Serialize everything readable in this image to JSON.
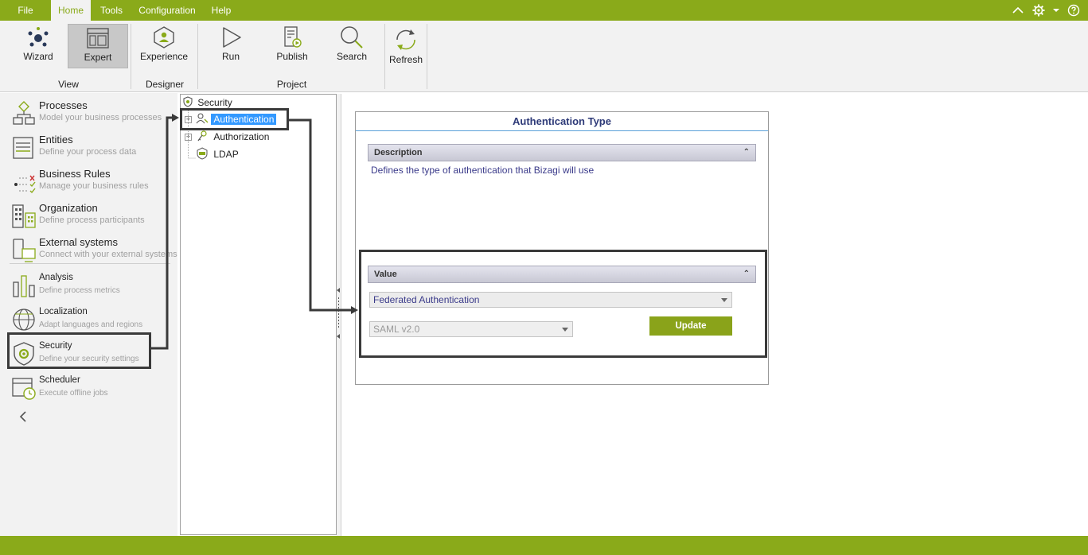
{
  "menu": {
    "items": [
      "File",
      "Home",
      "Tools",
      "Configuration",
      "Help"
    ],
    "active_index": 1
  },
  "ribbon": {
    "buttons": {
      "wizard": "Wizard",
      "expert": "Expert",
      "experience": "Experience",
      "run": "Run",
      "publish": "Publish",
      "search": "Search",
      "refresh": "Refresh"
    },
    "groups": {
      "view": "View",
      "designer": "Designer",
      "project": "Project"
    }
  },
  "leftnav": {
    "items": [
      {
        "title": "Processes",
        "subtitle": "Model your business processes",
        "icon": "processes-icon"
      },
      {
        "title": "Entities",
        "subtitle": "Define your process data",
        "icon": "entities-icon"
      },
      {
        "title": "Business Rules",
        "subtitle": "Manage your business rules",
        "icon": "business-rules-icon"
      },
      {
        "title": "Organization",
        "subtitle": "Define process participants",
        "icon": "organization-icon"
      },
      {
        "title": "External systems",
        "subtitle": "Connect with your external systems",
        "icon": "external-systems-icon"
      },
      {
        "title": "Analysis",
        "subtitle": "Define process metrics",
        "icon": "analysis-icon"
      },
      {
        "title": "Localization",
        "subtitle": "Adapt languages and regions",
        "icon": "localization-icon"
      },
      {
        "title": "Security",
        "subtitle": "Define your security settings",
        "icon": "security-icon"
      },
      {
        "title": "Scheduler",
        "subtitle": "Execute offline jobs",
        "icon": "scheduler-icon"
      }
    ],
    "selected": "Security"
  },
  "tree": {
    "root": "Security",
    "children": [
      "Authentication",
      "Authorization",
      "LDAP"
    ],
    "selected": "Authentication"
  },
  "form": {
    "title": "Authentication Type",
    "description_header": "Description",
    "description_text": "Defines the type of authentication that Bizagi will use",
    "value_header": "Value",
    "auth_type_value": "Federated Authentication",
    "protocol_value": "SAML v2.0",
    "update_label": "Update"
  },
  "colors": {
    "brand_green": "#8aaa1a",
    "selection_blue": "#3399ff",
    "form_title": "#2e3a78",
    "update_button": "#8aa31a"
  }
}
